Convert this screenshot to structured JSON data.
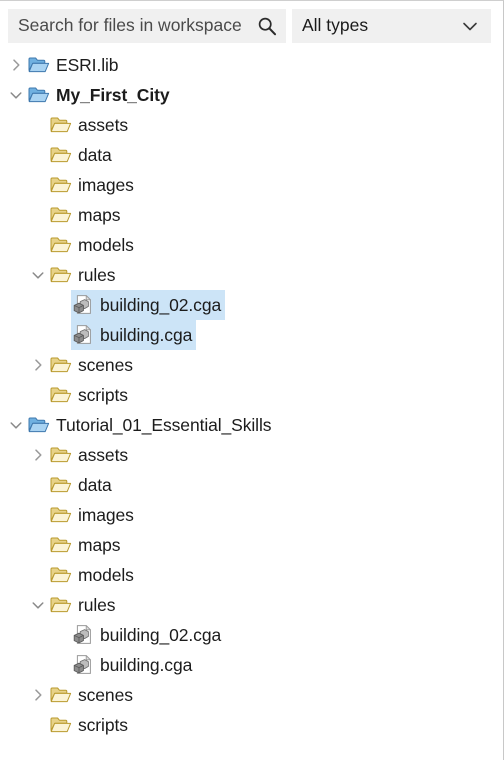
{
  "search": {
    "placeholder": "Search for files in workspace",
    "icon": "search-icon"
  },
  "type_filter": {
    "selected": "All types",
    "icon": "chevron-down-icon",
    "options": [
      "All types"
    ]
  },
  "colors": {
    "field_background": "#f0f0f0",
    "selection": "#cce4f7",
    "folder_top_level": "#5b9bd5",
    "folder_child": "#c9a227",
    "text": "#1c1c1c"
  },
  "tree": {
    "items": [
      {
        "label": "ESRI.lib",
        "level": 0,
        "icon": "folder-blue-icon",
        "twisty": "collapsed",
        "bold": false,
        "selected": false
      },
      {
        "label": "My_First_City",
        "level": 0,
        "icon": "folder-blue-icon",
        "twisty": "expanded",
        "bold": true,
        "selected": false
      },
      {
        "label": "assets",
        "level": 1,
        "icon": "folder-gold-icon",
        "twisty": "none",
        "bold": false,
        "selected": false
      },
      {
        "label": "data",
        "level": 1,
        "icon": "folder-gold-icon",
        "twisty": "none",
        "bold": false,
        "selected": false
      },
      {
        "label": "images",
        "level": 1,
        "icon": "folder-gold-icon",
        "twisty": "none",
        "bold": false,
        "selected": false
      },
      {
        "label": "maps",
        "level": 1,
        "icon": "folder-gold-icon",
        "twisty": "none",
        "bold": false,
        "selected": false
      },
      {
        "label": "models",
        "level": 1,
        "icon": "folder-gold-icon",
        "twisty": "none",
        "bold": false,
        "selected": false
      },
      {
        "label": "rules",
        "level": 1,
        "icon": "folder-gold-icon",
        "twisty": "expanded",
        "bold": false,
        "selected": false
      },
      {
        "label": "building_02.cga",
        "level": 2,
        "icon": "cga-file-icon",
        "twisty": "none",
        "bold": false,
        "selected": true
      },
      {
        "label": "building.cga",
        "level": 2,
        "icon": "cga-file-icon",
        "twisty": "none",
        "bold": false,
        "selected": true
      },
      {
        "label": "scenes",
        "level": 1,
        "icon": "folder-gold-icon",
        "twisty": "collapsed",
        "bold": false,
        "selected": false
      },
      {
        "label": "scripts",
        "level": 1,
        "icon": "folder-gold-icon",
        "twisty": "none",
        "bold": false,
        "selected": false
      },
      {
        "label": "Tutorial_01_Essential_Skills",
        "level": 0,
        "icon": "folder-blue-icon",
        "twisty": "expanded",
        "bold": false,
        "selected": false
      },
      {
        "label": "assets",
        "level": 1,
        "icon": "folder-gold-icon",
        "twisty": "collapsed",
        "bold": false,
        "selected": false
      },
      {
        "label": "data",
        "level": 1,
        "icon": "folder-gold-icon",
        "twisty": "none",
        "bold": false,
        "selected": false
      },
      {
        "label": "images",
        "level": 1,
        "icon": "folder-gold-icon",
        "twisty": "none",
        "bold": false,
        "selected": false
      },
      {
        "label": "maps",
        "level": 1,
        "icon": "folder-gold-icon",
        "twisty": "none",
        "bold": false,
        "selected": false
      },
      {
        "label": "models",
        "level": 1,
        "icon": "folder-gold-icon",
        "twisty": "none",
        "bold": false,
        "selected": false
      },
      {
        "label": "rules",
        "level": 1,
        "icon": "folder-gold-icon",
        "twisty": "expanded",
        "bold": false,
        "selected": false
      },
      {
        "label": "building_02.cga",
        "level": 2,
        "icon": "cga-file-icon",
        "twisty": "none",
        "bold": false,
        "selected": false
      },
      {
        "label": "building.cga",
        "level": 2,
        "icon": "cga-file-icon",
        "twisty": "none",
        "bold": false,
        "selected": false
      },
      {
        "label": "scenes",
        "level": 1,
        "icon": "folder-gold-icon",
        "twisty": "collapsed",
        "bold": false,
        "selected": false
      },
      {
        "label": "scripts",
        "level": 1,
        "icon": "folder-gold-icon",
        "twisty": "none",
        "bold": false,
        "selected": false
      }
    ]
  }
}
